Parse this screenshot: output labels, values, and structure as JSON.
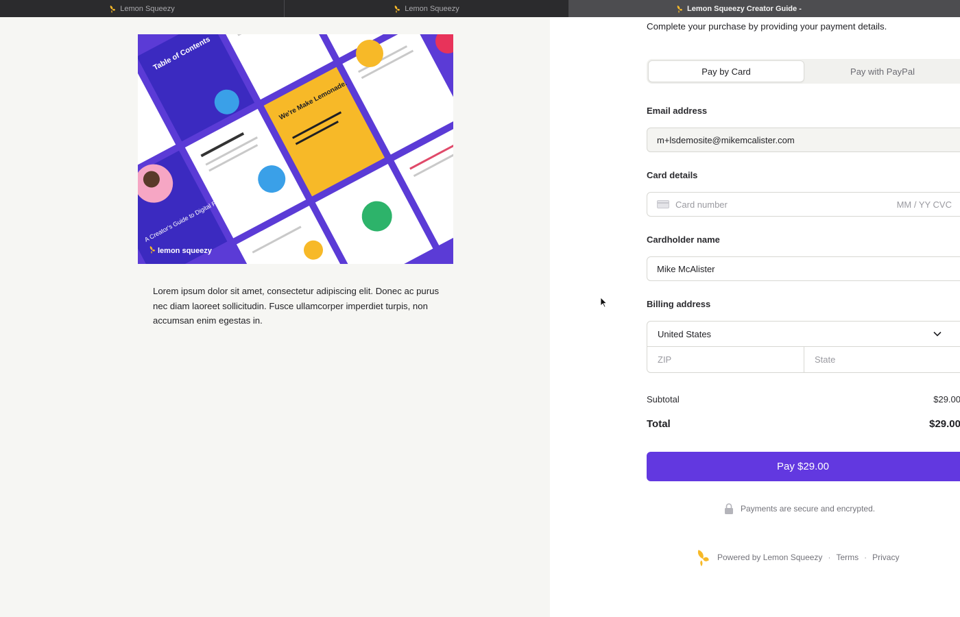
{
  "tabs": [
    {
      "label": "Lemon Squeezy",
      "active": false
    },
    {
      "label": "Lemon Squeezy",
      "active": false
    },
    {
      "label": "Lemon Squeezy Creator Guide -",
      "active": true
    }
  ],
  "product": {
    "hero_logo_text": "lemon squeezy",
    "hero_texts": {
      "cover_title": "A Creator's Guide to Digital Products",
      "toc_title": "Table of Contents",
      "lemonade_title": "We're Make Lemonade."
    },
    "description": "Lorem ipsum dolor sit amet, consectetur adipiscing elit. Donec ac purus nec diam laoreet sollicitudin. Fusce ullamcorper imperdiet turpis, non accumsan enim egestas in."
  },
  "checkout": {
    "intro": "Complete your purchase by providing your payment details.",
    "pay_tabs": [
      {
        "label": "Pay by Card",
        "active": true
      },
      {
        "label": "Pay with PayPal",
        "active": false
      }
    ],
    "email": {
      "label": "Email address",
      "value": "m+lsdemosite@mikemcalister.com"
    },
    "card": {
      "label": "Card details",
      "number_placeholder": "Card number",
      "expiry_cvc_placeholder": "MM / YY  CVC"
    },
    "cardholder": {
      "label": "Cardholder name",
      "value": "Mike McAlister"
    },
    "billing": {
      "label": "Billing address",
      "country": "United States",
      "zip_placeholder": "ZIP",
      "state_placeholder": "State"
    },
    "subtotal": {
      "label": "Subtotal",
      "value": "$29.00"
    },
    "total": {
      "label": "Total",
      "value": "$29.00"
    },
    "pay_button": "Pay $29.00",
    "secure_note": "Payments are secure and encrypted.",
    "footer": {
      "powered_by": "Powered by Lemon Squeezy",
      "terms": "Terms",
      "privacy": "Privacy"
    }
  },
  "colors": {
    "accent": "#6238e0",
    "hero_purple": "#5b3bd6",
    "lemon_yellow": "#f7b928",
    "left_bg": "#f6f6f3"
  }
}
